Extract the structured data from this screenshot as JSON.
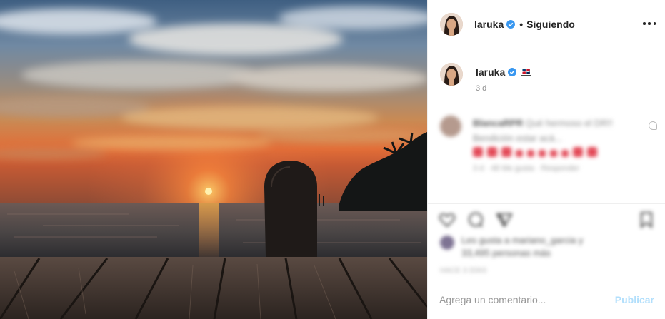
{
  "header": {
    "username": "laruka",
    "separator": "•",
    "follow_status": "Siguiendo",
    "more_icon": "more-options-icon"
  },
  "caption": {
    "username": "laruka",
    "emoji_glyph": "🇩🇴",
    "time": "3 d"
  },
  "comments": [
    {
      "username": "BlancaRPR",
      "text": "Qué hermoso el DR!! Bendición estar acá...",
      "meta": "3 d · 48 Me gusta · Responder"
    }
  ],
  "actions": {
    "icons": [
      "heart-icon",
      "comment-icon",
      "share-icon",
      "bookmark-icon"
    ],
    "likes_text": "Les gusta a mariano_garcia y 33,495 personas más",
    "date": "HACE 3 DÍAS"
  },
  "comment_box": {
    "placeholder": "Agrega un comentario...",
    "publish_label": "Publicar"
  },
  "colors": {
    "verified": "#3897f0",
    "publish_disabled": "#b2dffc",
    "divider": "#efefef"
  }
}
